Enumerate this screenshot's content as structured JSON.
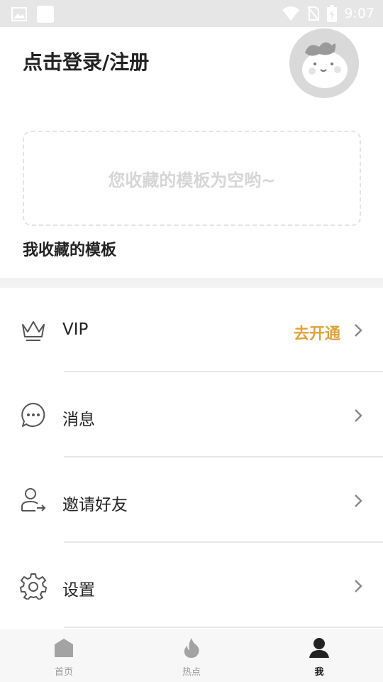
{
  "status_bar": {
    "time": "9:07",
    "icons": [
      "image-icon",
      "app-icon",
      "wifi-icon",
      "no-sim-icon",
      "battery-charging-icon"
    ]
  },
  "header": {
    "login_text": "点击登录/注册",
    "avatar_icon": "cartoon-avatar-icon"
  },
  "favorites": {
    "empty_text": "您收藏的模板为空哟~",
    "title": "我收藏的模板"
  },
  "menu": [
    {
      "label": "VIP",
      "extra": "去开通",
      "icon": "crown-icon"
    },
    {
      "label": "消息",
      "extra": "",
      "icon": "chat-bubble-icon"
    },
    {
      "label": "邀请好友",
      "extra": "",
      "icon": "invite-user-icon"
    },
    {
      "label": "设置",
      "extra": "",
      "icon": "gear-icon"
    }
  ],
  "bottom_nav": [
    {
      "label": "首页",
      "icon": "home-icon",
      "active": false
    },
    {
      "label": "热点",
      "icon": "flame-icon",
      "active": false
    },
    {
      "label": "我",
      "icon": "person-icon",
      "active": true
    }
  ],
  "colors": {
    "accent": "#e0a23d",
    "status_bar": "#e6e6e6",
    "text": "#222222",
    "muted": "#9a9a9a"
  }
}
